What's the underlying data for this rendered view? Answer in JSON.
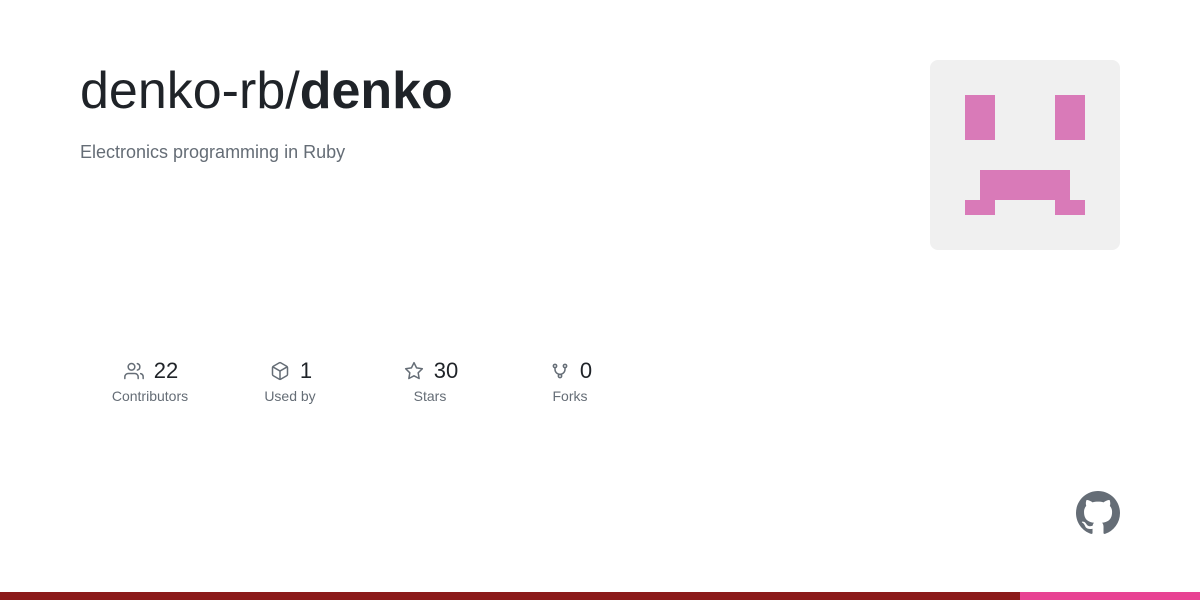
{
  "repo": {
    "owner": "denko-rb/",
    "name": "denko",
    "description": "Electronics programming in Ruby"
  },
  "stats": [
    {
      "id": "contributors",
      "count": "22",
      "label": "Contributors",
      "icon_type": "people"
    },
    {
      "id": "used-by",
      "count": "1",
      "label": "Used by",
      "icon_type": "package"
    },
    {
      "id": "stars",
      "count": "30",
      "label": "Stars",
      "icon_type": "star"
    },
    {
      "id": "forks",
      "count": "0",
      "label": "Forks",
      "icon_type": "fork"
    }
  ],
  "bottom_bar": {
    "left_color": "#8b1a1a",
    "right_color": "#e84393"
  }
}
